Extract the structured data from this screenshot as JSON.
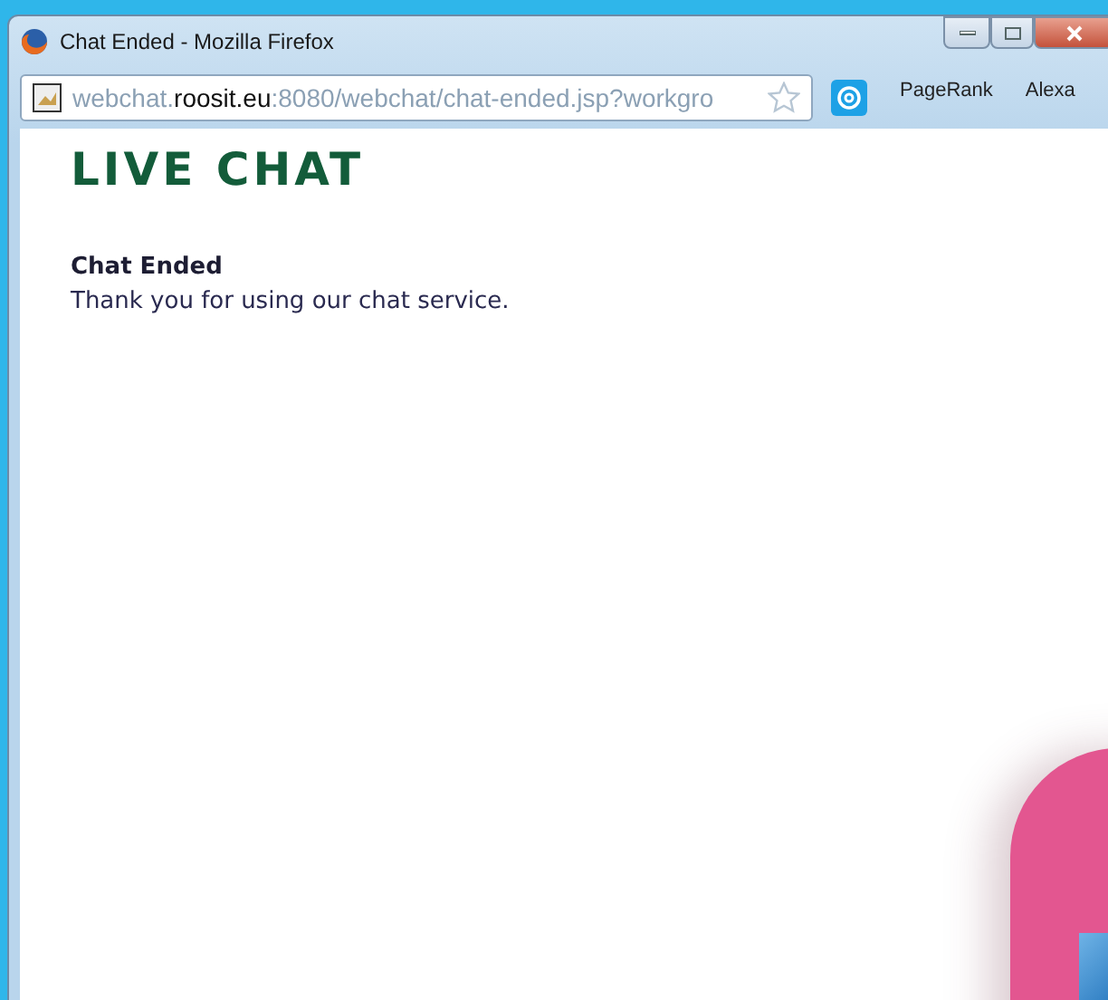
{
  "window": {
    "title": "Chat Ended - Mozilla Firefox"
  },
  "address_bar": {
    "url_parts": [
      {
        "text": "webchat.",
        "kind": "dim"
      },
      {
        "text": "roosit.eu",
        "kind": "domain"
      },
      {
        "text": ":8080/webchat/chat-ended.jsp?workgro",
        "kind": "dim"
      }
    ]
  },
  "toolbar_items": [
    "PageRank",
    "Alexa"
  ],
  "page": {
    "logo": "LIVE CHAT",
    "heading": "Chat Ended",
    "message": "Thank you for using our chat service."
  }
}
